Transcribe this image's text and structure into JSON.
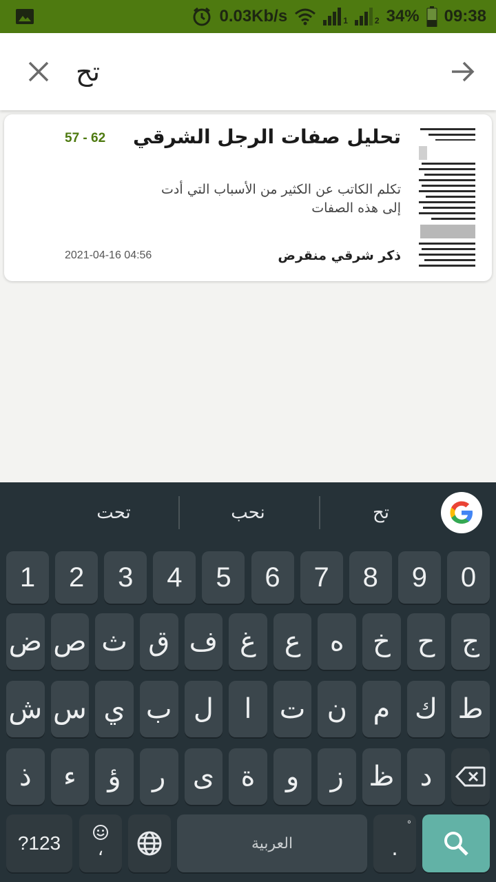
{
  "status_bar": {
    "network_speed": "0.03Kb/s",
    "battery": "34%",
    "time": "09:38",
    "sim1": "1",
    "sim2": "2",
    "icons": [
      "image-icon",
      "alarm-icon",
      "wifi-icon",
      "signal-icon",
      "battery-icon"
    ]
  },
  "search": {
    "value": "تح",
    "close_icon": "close-icon",
    "submit_icon": "arrow-right-icon"
  },
  "result": {
    "title": "تحليل صفات الرجل الشرقي",
    "pages": "57 - 62",
    "description": "تكلم الكاتب عن الكثير من الأسباب التي أدت إلى هذه الصفات",
    "author": "ذكر شرقي منقرض",
    "date": "2021-04-16 04:56",
    "accent_color": "#4e7a10"
  },
  "keyboard": {
    "suggestions": [
      "تح",
      "نحب",
      "تحت"
    ],
    "row_numbers": [
      "1",
      "2",
      "3",
      "4",
      "5",
      "6",
      "7",
      "8",
      "9",
      "0"
    ],
    "row1": [
      "ض",
      "ص",
      "ث",
      "ق",
      "ف",
      "غ",
      "ع",
      "ه",
      "خ",
      "ح",
      "ج"
    ],
    "row2": [
      "ش",
      "س",
      "ي",
      "ب",
      "ل",
      "ا",
      "ت",
      "ن",
      "م",
      "ك",
      "ط"
    ],
    "row3": [
      "ذ",
      "ء",
      "ؤ",
      "ر",
      "ى",
      "ة",
      "و",
      "ز",
      "ظ",
      "د"
    ],
    "symbols_label": "?123",
    "comma_label": "،",
    "space_label": "العربية",
    "period_label": ".",
    "period_alt": "ْ",
    "emoji_icon": "emoji-icon",
    "globe_icon": "globe-icon",
    "backspace_icon": "backspace-icon",
    "search_icon": "search-icon"
  }
}
